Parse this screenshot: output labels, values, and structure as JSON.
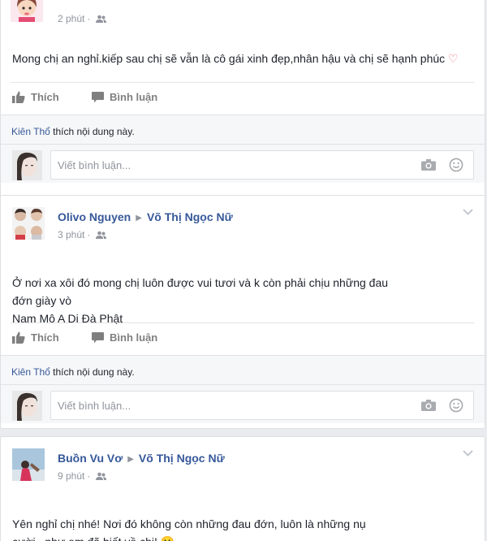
{
  "posts": [
    {
      "author": "",
      "target": "",
      "time": "2 phút",
      "text": "Mong chị an nghỉ.kiếp sau chị sẽ vẫn là cô gái xinh đẹp,nhân hậu và chị sẽ hạnh phúc ♡",
      "like_label": "Thích",
      "comment_label": "Bình luận",
      "liker": "Kiên Thổ",
      "liked_text": " thích nội dung này.",
      "comment_placeholder": "Viết bình luận..."
    },
    {
      "author": "Olivo Nguyen",
      "target": "Võ Thị Ngọc Nữ",
      "time": "3 phút",
      "text": "Ở nơi xa xôi đó mong chị luôn được vui tươi và k còn phải chịu những đau\nđớn giày vò\nNam Mô A Di Đà Phật",
      "like_label": "Thích",
      "comment_label": "Bình luận",
      "liker": "Kiên Thổ",
      "liked_text": " thích nội dung này.",
      "comment_placeholder": "Viết bình luận..."
    },
    {
      "author": "Buồn Vu Vơ",
      "target": "Võ Thị Ngọc Nữ",
      "time": "9 phút",
      "text": "Yên nghỉ chị nhé! Nơi đó không còn những đau đớn, luôn là những nụ\ncười...như em đã biết về chị! 🙂"
    }
  ],
  "colors": {
    "link": "#365899",
    "meta": "#90949c",
    "heart": "#e9737a"
  }
}
